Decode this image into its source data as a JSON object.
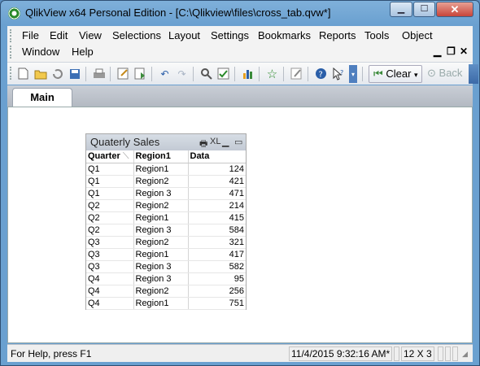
{
  "window": {
    "title": "QlikView x64 Personal Edition - [C:\\Qlikview\\files\\cross_tab.qvw*]",
    "min_icon": "minimize-icon",
    "max_icon": "maximize-icon",
    "close_icon": "close-icon"
  },
  "menu": {
    "items": [
      "File",
      "Edit",
      "View",
      "Selections",
      "Layout",
      "Settings",
      "Bookmarks",
      "Reports",
      "Tools",
      "Object",
      "Window",
      "Help"
    ]
  },
  "toolbar": {
    "clear_label": "Clear",
    "back_label": "Back"
  },
  "tabs": {
    "main": "Main"
  },
  "table": {
    "title": "Quaterly Sales",
    "xl_label": "XL",
    "headers": [
      "Quarter",
      "Region1",
      "Data"
    ],
    "rows": [
      [
        "Q1",
        "Region1",
        "124"
      ],
      [
        "Q1",
        "Region2",
        "421"
      ],
      [
        "Q1",
        "Region 3",
        "471"
      ],
      [
        "Q2",
        "Region2",
        "214"
      ],
      [
        "Q2",
        "Region1",
        "415"
      ],
      [
        "Q2",
        "Region 3",
        "584"
      ],
      [
        "Q3",
        "Region2",
        "321"
      ],
      [
        "Q3",
        "Region1",
        "417"
      ],
      [
        "Q3",
        "Region 3",
        "582"
      ],
      [
        "Q4",
        "Region 3",
        "95"
      ],
      [
        "Q4",
        "Region2",
        "256"
      ],
      [
        "Q4",
        "Region1",
        "751"
      ]
    ]
  },
  "status": {
    "help": "For Help, press F1",
    "timestamp": "11/4/2015 9:32:16 AM*",
    "dimensions": "12 X 3"
  }
}
